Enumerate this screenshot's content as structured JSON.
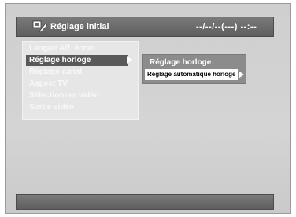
{
  "header": {
    "title": "Réglage initial",
    "datetime": "--/--/--(---)   --:--",
    "icon": "setup-tools-icon"
  },
  "menu": {
    "items": [
      {
        "label": "Langue Aff. écran",
        "selected": false
      },
      {
        "label": "Réglage horloge",
        "selected": true
      },
      {
        "label": "Réglage canal",
        "selected": false
      },
      {
        "label": "Aspect TV",
        "selected": false
      },
      {
        "label": "Sélectionner vidéo",
        "selected": false
      },
      {
        "label": "Sortie vidéo",
        "selected": false
      }
    ]
  },
  "submenu": {
    "title": "Réglage horloge",
    "item": "Réglage automatique horloge"
  }
}
